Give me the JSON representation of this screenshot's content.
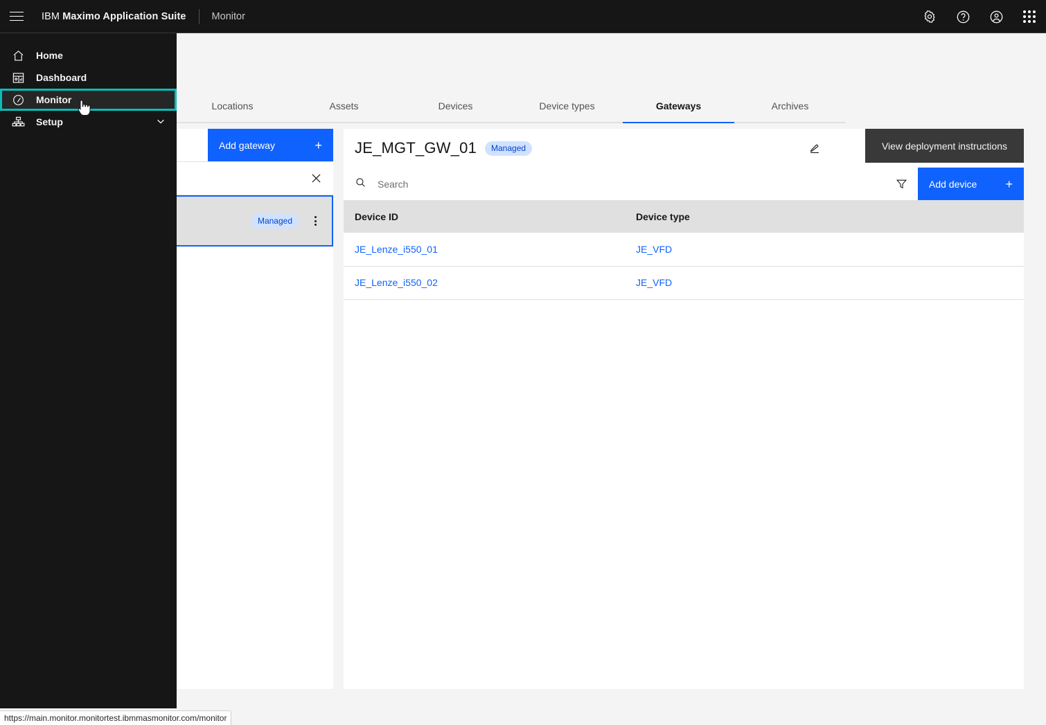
{
  "header": {
    "menu_icon": "hamburger-menu-icon",
    "brand_prefix": "IBM",
    "brand_name": "Maximo Application Suite",
    "app_name": "Monitor",
    "actions": [
      {
        "name": "settings-icon",
        "label": "Settings"
      },
      {
        "name": "help-icon",
        "label": "Help"
      },
      {
        "name": "user-avatar-icon",
        "label": "Profile"
      },
      {
        "name": "app-switcher-icon",
        "label": "App switcher"
      }
    ]
  },
  "sidebar": {
    "items": [
      {
        "label": "Home",
        "icon": "home-icon",
        "active": false,
        "expandable": false
      },
      {
        "label": "Dashboard",
        "icon": "dashboard-icon",
        "active": false,
        "expandable": false
      },
      {
        "label": "Monitor",
        "icon": "monitor-gauge-icon",
        "active": true,
        "expandable": false
      },
      {
        "label": "Setup",
        "icon": "setup-hierarchy-icon",
        "active": false,
        "expandable": true
      }
    ]
  },
  "tabs": [
    {
      "label": "Locations",
      "selected": false
    },
    {
      "label": "Assets",
      "selected": false
    },
    {
      "label": "Devices",
      "selected": false
    },
    {
      "label": "Device types",
      "selected": false
    },
    {
      "label": "Gateways",
      "selected": true
    },
    {
      "label": "Archives",
      "selected": false
    }
  ],
  "left_panel": {
    "add_gateway_label": "Add gateway",
    "add_gateway_plus": "+",
    "close_icon": "close-x-icon",
    "gateway_card": {
      "status_tag": "Managed",
      "overflow_icon": "overflow-menu-icon"
    }
  },
  "detail": {
    "title": "JE_MGT_GW_01",
    "status_tag": "Managed",
    "edit_icon": "edit-pencil-icon",
    "tooltip": "View deployment instructions",
    "search": {
      "icon": "search-icon",
      "value": "",
      "placeholder": "Search"
    },
    "filter_icon": "filter-icon",
    "add_device_label": "Add device",
    "add_device_plus": "+",
    "table": {
      "columns": [
        "Device ID",
        "Device type"
      ],
      "rows": [
        {
          "device_id": "JE_Lenze_i550_01",
          "device_type": "JE_VFD"
        },
        {
          "device_id": "JE_Lenze_i550_02",
          "device_type": "JE_VFD"
        }
      ]
    }
  },
  "status_bar": {
    "url": "https://main.monitor.monitortest.ibmmasmonitor.com/monitor"
  },
  "colors": {
    "brand_blue": "#0f62fe",
    "accent_teal": "#08bdba",
    "header_bg": "#161616",
    "tag_bg": "#d0e2ff",
    "tag_text": "#0043ce"
  }
}
